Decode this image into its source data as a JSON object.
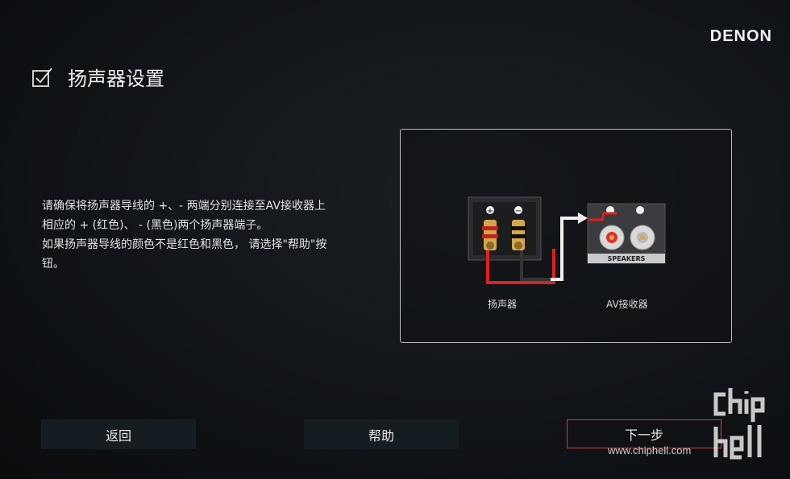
{
  "brand": {
    "name": "DENON"
  },
  "header": {
    "title": "扬声器设置",
    "check_icon": "checkbox-checked-icon"
  },
  "instructions": {
    "line1": "请确保将扬声器导线的 +、- 两端分别连接至AV接收器上",
    "line2": "相应的 + (红色)、 - (黑色)两个扬声器端子。",
    "line3": "如果扬声器导线的颜色不是红色和黑色， 请选择\"帮助\"按",
    "line4": "钮。"
  },
  "diagram": {
    "speaker_label": "扬声器",
    "receiver_label": "AV接收器",
    "speakers_plate": "SPEAKERS",
    "plus": "+",
    "minus": "−",
    "colors": {
      "positive_wire": "#e02020",
      "negative_wire": "#222222",
      "gold": "#d4a74a"
    }
  },
  "footer": {
    "back_label": "返回",
    "help_label": "帮助",
    "next_label": "下一步",
    "next_border_color": "#d0413a"
  },
  "watermark": {
    "url": "www.chiphell.com",
    "logo_text": "chip hell"
  }
}
